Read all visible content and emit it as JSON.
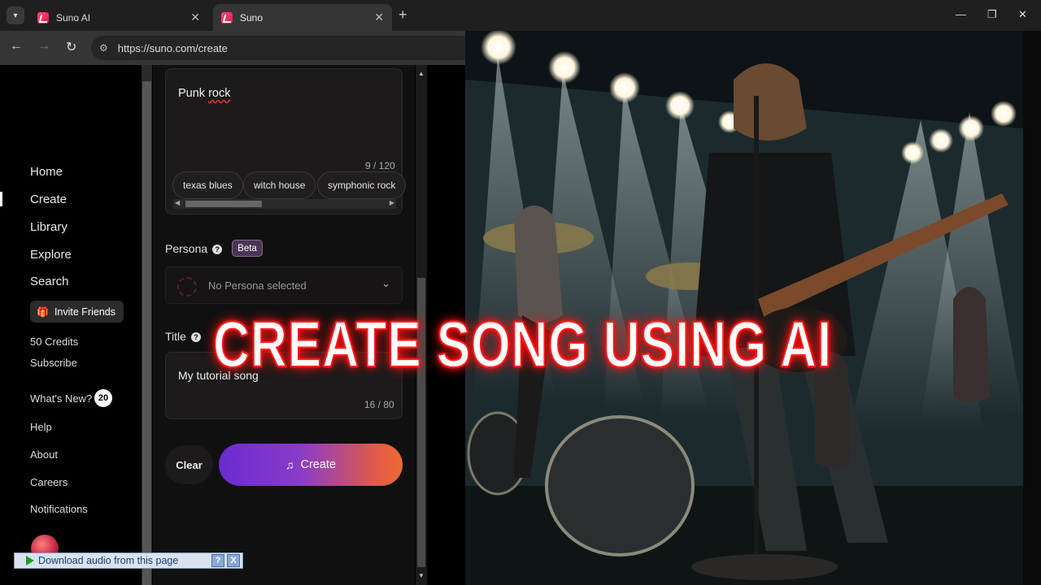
{
  "browser": {
    "tabs": [
      {
        "title": "Suno AI"
      },
      {
        "title": "Suno"
      }
    ],
    "url": "https://suno.com/create"
  },
  "sidebar": {
    "items": [
      {
        "label": "Home"
      },
      {
        "label": "Create"
      },
      {
        "label": "Library"
      },
      {
        "label": "Explore"
      },
      {
        "label": "Search"
      }
    ],
    "invite_label": "Invite Friends",
    "credits": "50 Credits",
    "subscribe": "Subscribe",
    "whats_new": "What's New?",
    "whats_new_count": "20",
    "links": [
      {
        "label": "Help"
      },
      {
        "label": "About"
      },
      {
        "label": "Careers"
      },
      {
        "label": "Notifications"
      }
    ]
  },
  "create_panel": {
    "style_value_prefix": "Punk ",
    "style_value_suffix": "rock",
    "style_counter": "9 / 120",
    "style_chips": [
      "texas blues",
      "witch house",
      "symphonic rock"
    ],
    "persona_label": "Persona",
    "persona_badge": "Beta",
    "persona_placeholder": "No Persona selected",
    "title_label": "Title",
    "title_value": "My tutorial song",
    "title_counter": "16 / 80",
    "clear_label": "Clear",
    "create_label": "Create"
  },
  "overlay": {
    "headline": "CREATE SONG USING AI",
    "headline_color": "#ff2020"
  },
  "download_bar": {
    "label": "Download audio from this page",
    "help": "?",
    "close": "X"
  },
  "colors": {
    "create_gradient_start": "#6b2bd0",
    "create_gradient_end": "#f06a30",
    "beta_badge": "#4a3556"
  }
}
